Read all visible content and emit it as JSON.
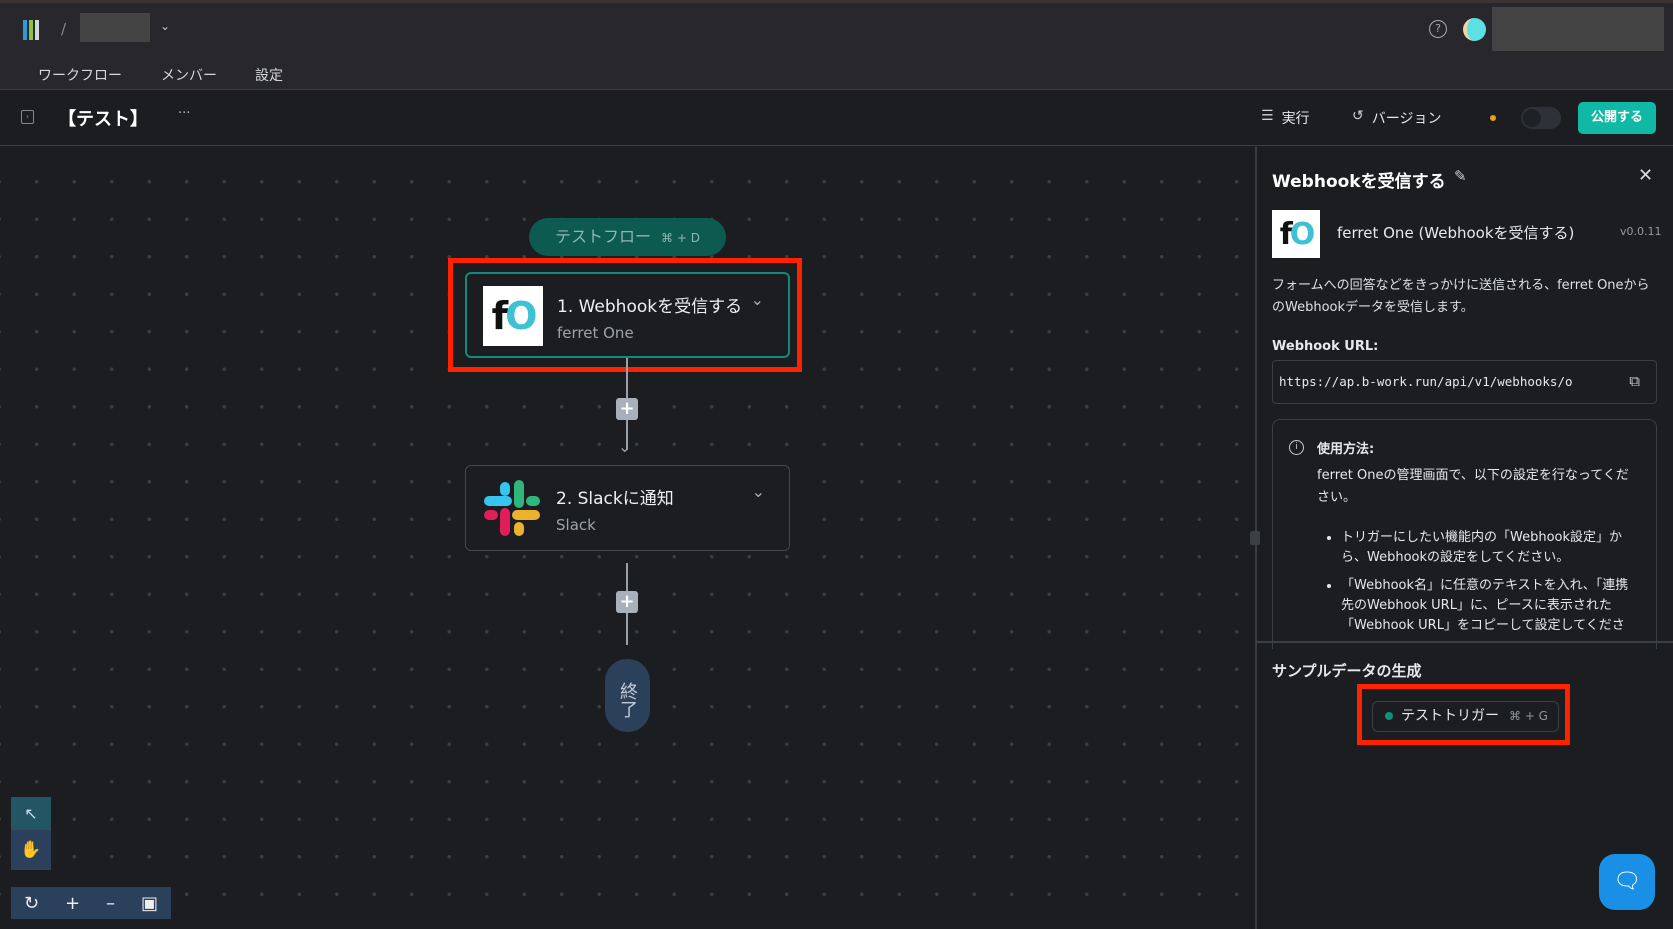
{
  "header": {
    "nav": [
      "ワークフロー",
      "メンバー",
      "設定"
    ],
    "breadcrumb_separator": "/"
  },
  "toolbar": {
    "title": "【テスト】",
    "more": "···",
    "run_label": "実行",
    "version_label": "バージョン",
    "publish_label": "公開する"
  },
  "canvas": {
    "test_flow": {
      "label": "テストフロー",
      "shortcut": "⌘ + D"
    },
    "nodes": [
      {
        "title": "1. Webhookを受信する",
        "subtitle": "ferret One",
        "selected": true
      },
      {
        "title": "2. Slackに通知",
        "subtitle": "Slack",
        "selected": false
      }
    ],
    "end_label": "終了",
    "add_step": "+"
  },
  "panel": {
    "title": "Webhookを受信する",
    "piece_name": "ferret One (Webhookを受信する)",
    "version": "v0.0.11",
    "description": "フォームへの回答などをきっかけに送信される、ferret OneからのWebhookデータを受信します。",
    "url_label": "Webhook URL:",
    "url_value": "https://ap.b-work.run/api/v1/webhooks/o",
    "usage_title": "使用方法:",
    "usage_intro": "ferret Oneの管理画面で、以下の設定を行なってください。",
    "usage_steps": [
      "トリガーにしたい機能内の「Webhook設定」から、Webhookの設定をしてください。",
      "「Webhook名」に任意のテキストを入れ、「連携先のWebhook URL」に、ピースに表示された「Webhook URL」をコピーして設定してくださ"
    ],
    "sample_title": "サンプルデータの生成",
    "test_trigger": {
      "label": "テストトリガー",
      "shortcut": "⌘ + G"
    }
  },
  "colors": {
    "accent": "#0fb9a5",
    "status_dot": "#e7a11b",
    "highlight": "#ff2200"
  }
}
